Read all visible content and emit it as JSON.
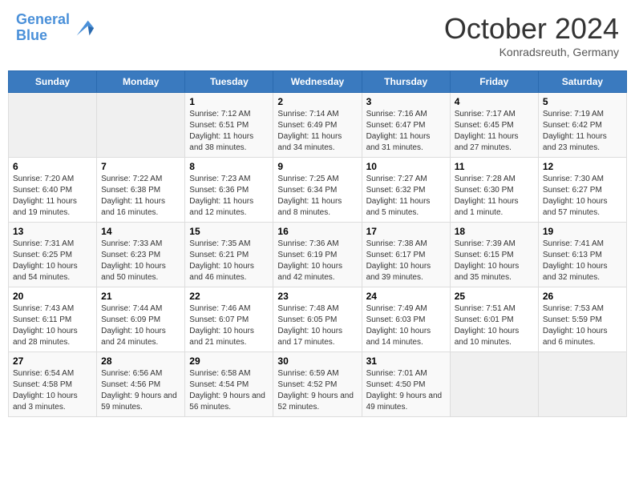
{
  "header": {
    "logo_line1": "General",
    "logo_line2": "Blue",
    "month": "October 2024",
    "location": "Konradsreuth, Germany"
  },
  "days_of_week": [
    "Sunday",
    "Monday",
    "Tuesday",
    "Wednesday",
    "Thursday",
    "Friday",
    "Saturday"
  ],
  "weeks": [
    [
      {
        "num": "",
        "detail": ""
      },
      {
        "num": "",
        "detail": ""
      },
      {
        "num": "1",
        "detail": "Sunrise: 7:12 AM\nSunset: 6:51 PM\nDaylight: 11 hours and 38 minutes."
      },
      {
        "num": "2",
        "detail": "Sunrise: 7:14 AM\nSunset: 6:49 PM\nDaylight: 11 hours and 34 minutes."
      },
      {
        "num": "3",
        "detail": "Sunrise: 7:16 AM\nSunset: 6:47 PM\nDaylight: 11 hours and 31 minutes."
      },
      {
        "num": "4",
        "detail": "Sunrise: 7:17 AM\nSunset: 6:45 PM\nDaylight: 11 hours and 27 minutes."
      },
      {
        "num": "5",
        "detail": "Sunrise: 7:19 AM\nSunset: 6:42 PM\nDaylight: 11 hours and 23 minutes."
      }
    ],
    [
      {
        "num": "6",
        "detail": "Sunrise: 7:20 AM\nSunset: 6:40 PM\nDaylight: 11 hours and 19 minutes."
      },
      {
        "num": "7",
        "detail": "Sunrise: 7:22 AM\nSunset: 6:38 PM\nDaylight: 11 hours and 16 minutes."
      },
      {
        "num": "8",
        "detail": "Sunrise: 7:23 AM\nSunset: 6:36 PM\nDaylight: 11 hours and 12 minutes."
      },
      {
        "num": "9",
        "detail": "Sunrise: 7:25 AM\nSunset: 6:34 PM\nDaylight: 11 hours and 8 minutes."
      },
      {
        "num": "10",
        "detail": "Sunrise: 7:27 AM\nSunset: 6:32 PM\nDaylight: 11 hours and 5 minutes."
      },
      {
        "num": "11",
        "detail": "Sunrise: 7:28 AM\nSunset: 6:30 PM\nDaylight: 11 hours and 1 minute."
      },
      {
        "num": "12",
        "detail": "Sunrise: 7:30 AM\nSunset: 6:27 PM\nDaylight: 10 hours and 57 minutes."
      }
    ],
    [
      {
        "num": "13",
        "detail": "Sunrise: 7:31 AM\nSunset: 6:25 PM\nDaylight: 10 hours and 54 minutes."
      },
      {
        "num": "14",
        "detail": "Sunrise: 7:33 AM\nSunset: 6:23 PM\nDaylight: 10 hours and 50 minutes."
      },
      {
        "num": "15",
        "detail": "Sunrise: 7:35 AM\nSunset: 6:21 PM\nDaylight: 10 hours and 46 minutes."
      },
      {
        "num": "16",
        "detail": "Sunrise: 7:36 AM\nSunset: 6:19 PM\nDaylight: 10 hours and 42 minutes."
      },
      {
        "num": "17",
        "detail": "Sunrise: 7:38 AM\nSunset: 6:17 PM\nDaylight: 10 hours and 39 minutes."
      },
      {
        "num": "18",
        "detail": "Sunrise: 7:39 AM\nSunset: 6:15 PM\nDaylight: 10 hours and 35 minutes."
      },
      {
        "num": "19",
        "detail": "Sunrise: 7:41 AM\nSunset: 6:13 PM\nDaylight: 10 hours and 32 minutes."
      }
    ],
    [
      {
        "num": "20",
        "detail": "Sunrise: 7:43 AM\nSunset: 6:11 PM\nDaylight: 10 hours and 28 minutes."
      },
      {
        "num": "21",
        "detail": "Sunrise: 7:44 AM\nSunset: 6:09 PM\nDaylight: 10 hours and 24 minutes."
      },
      {
        "num": "22",
        "detail": "Sunrise: 7:46 AM\nSunset: 6:07 PM\nDaylight: 10 hours and 21 minutes."
      },
      {
        "num": "23",
        "detail": "Sunrise: 7:48 AM\nSunset: 6:05 PM\nDaylight: 10 hours and 17 minutes."
      },
      {
        "num": "24",
        "detail": "Sunrise: 7:49 AM\nSunset: 6:03 PM\nDaylight: 10 hours and 14 minutes."
      },
      {
        "num": "25",
        "detail": "Sunrise: 7:51 AM\nSunset: 6:01 PM\nDaylight: 10 hours and 10 minutes."
      },
      {
        "num": "26",
        "detail": "Sunrise: 7:53 AM\nSunset: 5:59 PM\nDaylight: 10 hours and 6 minutes."
      }
    ],
    [
      {
        "num": "27",
        "detail": "Sunrise: 6:54 AM\nSunset: 4:58 PM\nDaylight: 10 hours and 3 minutes."
      },
      {
        "num": "28",
        "detail": "Sunrise: 6:56 AM\nSunset: 4:56 PM\nDaylight: 9 hours and 59 minutes."
      },
      {
        "num": "29",
        "detail": "Sunrise: 6:58 AM\nSunset: 4:54 PM\nDaylight: 9 hours and 56 minutes."
      },
      {
        "num": "30",
        "detail": "Sunrise: 6:59 AM\nSunset: 4:52 PM\nDaylight: 9 hours and 52 minutes."
      },
      {
        "num": "31",
        "detail": "Sunrise: 7:01 AM\nSunset: 4:50 PM\nDaylight: 9 hours and 49 minutes."
      },
      {
        "num": "",
        "detail": ""
      },
      {
        "num": "",
        "detail": ""
      }
    ]
  ]
}
